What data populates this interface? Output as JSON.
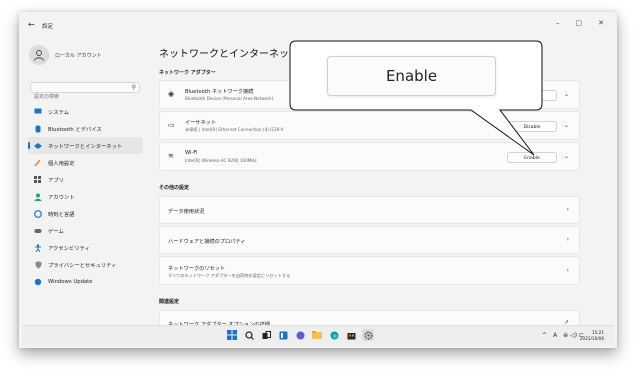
{
  "window": {
    "back": "←",
    "title": "設定",
    "controls": {
      "minimize": "–",
      "maximize": "▢",
      "close": "✕"
    }
  },
  "profile": {
    "name": "ローカル アカウント"
  },
  "search": {
    "placeholder": "設定の検索"
  },
  "nav": {
    "items": [
      {
        "label": "システム",
        "icon": "monitor-icon",
        "color": "#1a73c9"
      },
      {
        "label": "Bluetooth とデバイス",
        "icon": "bluetooth-icon",
        "color": "#1a73c9"
      },
      {
        "label": "ネットワークとインターネット",
        "icon": "network-icon",
        "color": "#1a73c9",
        "selected": true
      },
      {
        "label": "個人用設定",
        "icon": "brush-icon",
        "color": "#e58b2c"
      },
      {
        "label": "アプリ",
        "icon": "apps-icon",
        "color": "#555555"
      },
      {
        "label": "アカウント",
        "icon": "person-icon",
        "color": "#2aa36a"
      },
      {
        "label": "時刻と言語",
        "icon": "globe-icon",
        "color": "#1a73c9"
      },
      {
        "label": "ゲーム",
        "icon": "gamepad-icon",
        "color": "#555555"
      },
      {
        "label": "アクセシビリティ",
        "icon": "accessibility-icon",
        "color": "#1a73c9"
      },
      {
        "label": "プライバシーとセキュリティ",
        "icon": "shield-icon",
        "color": "#777777"
      },
      {
        "label": "Windows Update",
        "icon": "update-icon",
        "color": "#1a73c9"
      }
    ]
  },
  "main": {
    "title": "ネットワークとインターネット",
    "adapters_label": "ネットワーク アダプター",
    "adapters": [
      {
        "name": "Bluetooth ネットワーク接続",
        "desc": "Bluetooth Device (Personal Area Network)",
        "icon": "bluetooth-network-icon",
        "state": ""
      },
      {
        "name": "イーサネット",
        "desc": "未接続 | Intel(R) Ethernet Connection (4) I219-V",
        "icon": "ethernet-icon",
        "state": "Disable"
      },
      {
        "name": "Wi-Fi",
        "desc": "Intel(R) Wireless-AC 9260 160MHz",
        "icon": "wifi-icon",
        "state": "Enable"
      }
    ],
    "other_label": "その他の設定",
    "other": [
      {
        "name": "データ使用状況"
      },
      {
        "name": "ハードウェアと接続のプロパティ"
      },
      {
        "name": "ネットワークのリセット",
        "desc": "すべてのネットワーク アダプターを出荷時の設定にリセットする"
      }
    ],
    "related_label": "関連設定",
    "related_partial": "ネットワーク アダプター オプションの詳細"
  },
  "callout": {
    "text": "Enable"
  },
  "taskbar": {
    "icons": [
      "windows-start-icon",
      "search-icon",
      "task-view-icon",
      "widgets-icon",
      "chat-icon",
      "file-explorer-icon",
      "edge-icon",
      "store-icon",
      "settings-icon"
    ],
    "tray": {
      "chevron": "^",
      "ime": "A",
      "symbols": "⊕ ◁) ⊏"
    },
    "time": "15:21",
    "date": "2021/10/06"
  },
  "colors": {
    "accent": "#1a73c9"
  }
}
